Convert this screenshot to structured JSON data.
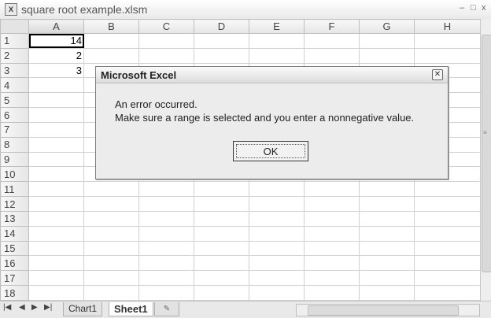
{
  "window": {
    "title": "square root example.xlsm",
    "min_glyph": "–",
    "restore_glyph": "□",
    "close_glyph": "x"
  },
  "grid": {
    "columns": [
      "A",
      "B",
      "C",
      "D",
      "E",
      "F",
      "G",
      "H"
    ],
    "rows": [
      "1",
      "2",
      "3",
      "4",
      "5",
      "6",
      "7",
      "8",
      "9",
      "10",
      "11",
      "12",
      "13",
      "14",
      "15",
      "16",
      "17",
      "18"
    ],
    "cells": {
      "A1": "14",
      "A2": "2",
      "A3": "3"
    }
  },
  "sheet_tabs": {
    "chart": "Chart1",
    "active": "Sheet1"
  },
  "dialog": {
    "title": "Microsoft Excel",
    "line1": "An error occurred.",
    "line2": "Make sure a range is selected and you enter a nonnegative value.",
    "ok_label": "OK"
  }
}
